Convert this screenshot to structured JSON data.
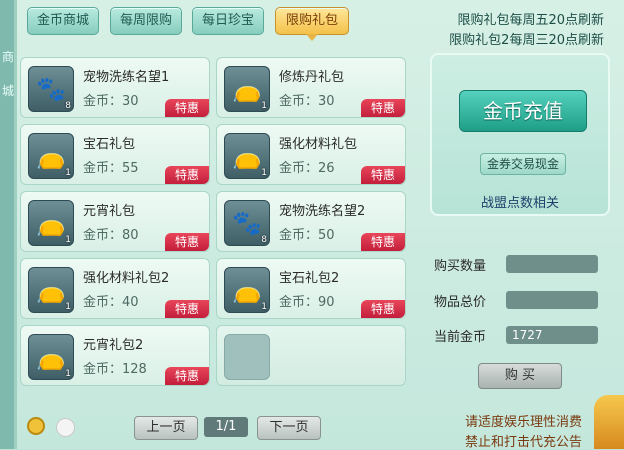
{
  "tabs": [
    {
      "label": "金币商城",
      "active": false
    },
    {
      "label": "每周限购",
      "active": false
    },
    {
      "label": "每日珍宝",
      "active": false
    },
    {
      "label": "限购礼包",
      "active": true
    }
  ],
  "notices": [
    "限购礼包每周五20点刷新",
    "限购礼包2每周三20点刷新"
  ],
  "side_text": [
    "商",
    "城"
  ],
  "items": [
    {
      "name": "宠物洗练名望1",
      "price": "金币：30",
      "qty": "8",
      "badge": "特惠",
      "icon": "paw-icon"
    },
    {
      "name": "修炼丹礼包",
      "price": "金币：30",
      "qty": "1",
      "badge": "特惠",
      "icon": "gift-bag-icon"
    },
    {
      "name": "宝石礼包",
      "price": "金币：55",
      "qty": "1",
      "badge": "特惠",
      "icon": "gift-bag-icon"
    },
    {
      "name": "强化材料礼包",
      "price": "金币：26",
      "qty": "1",
      "badge": "特惠",
      "icon": "gift-bag-icon"
    },
    {
      "name": "元宵礼包",
      "price": "金币：80",
      "qty": "1",
      "badge": "特惠",
      "icon": "gift-bag-icon"
    },
    {
      "name": "宠物洗练名望2",
      "price": "金币：50",
      "qty": "8",
      "badge": "特惠",
      "icon": "paw-icon"
    },
    {
      "name": "强化材料礼包2",
      "price": "金币：40",
      "qty": "1",
      "badge": "特惠",
      "icon": "gift-bag-icon"
    },
    {
      "name": "宝石礼包2",
      "price": "金币：90",
      "qty": "1",
      "badge": "特惠",
      "icon": "gift-bag-icon"
    },
    {
      "name": "元宵礼包2",
      "price": "金币：128",
      "qty": "1",
      "badge": "特惠",
      "icon": "gift-bag-icon"
    }
  ],
  "recharge": {
    "label": "金币充值",
    "exchange_label": "金券交易现金",
    "alliance_link": "战盟点数相关"
  },
  "purchase": {
    "qty_label": "购买数量",
    "qty_value": "",
    "total_label": "物品总价",
    "total_value": "",
    "gold_label": "当前金币",
    "gold_value": "1727",
    "buy_label": "购 买"
  },
  "pager": {
    "prev": "上一页",
    "page": "1/1",
    "next": "下一页"
  },
  "footer_tips": [
    "请适度娱乐理性消费",
    "禁止和打击代充公告"
  ],
  "colors": {
    "badge": "#d8314a",
    "active_tab": "#f3c14a",
    "recharge": "#2bb39c"
  }
}
